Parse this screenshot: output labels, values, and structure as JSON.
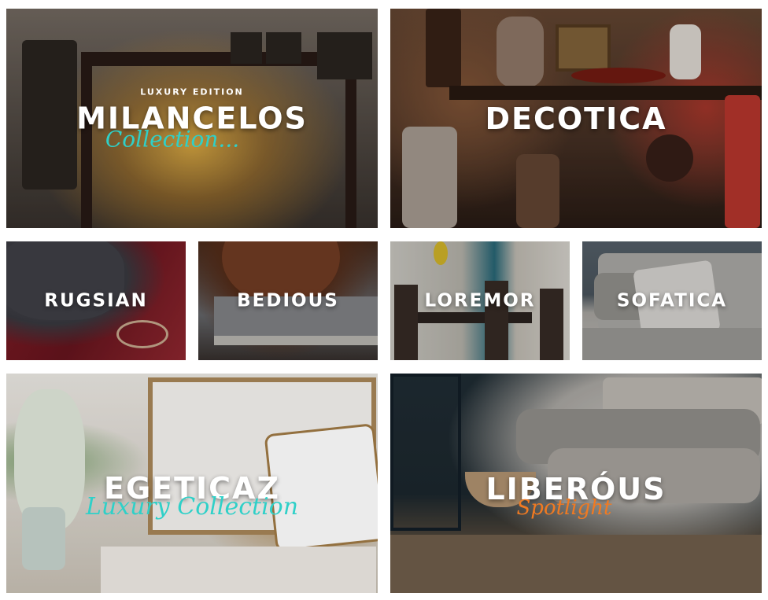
{
  "tiles": [
    {
      "title": "MILANCELOS",
      "kicker": "LUXURY EDITION",
      "script": "Collection...",
      "script_color": "#2fd0c8"
    },
    {
      "title": "DECOTICA"
    },
    {
      "title": "RUGSIAN"
    },
    {
      "title": "BEDIOUS"
    },
    {
      "title": "LOREMOR"
    },
    {
      "title": "SOFATICA"
    },
    {
      "title": "EGETICAZ",
      "script": "Luxury Collection",
      "script_color": "#2fd0c8"
    },
    {
      "title": "LIBERÓUS",
      "script": "Spotlight",
      "script_color": "#f07a22"
    }
  ]
}
